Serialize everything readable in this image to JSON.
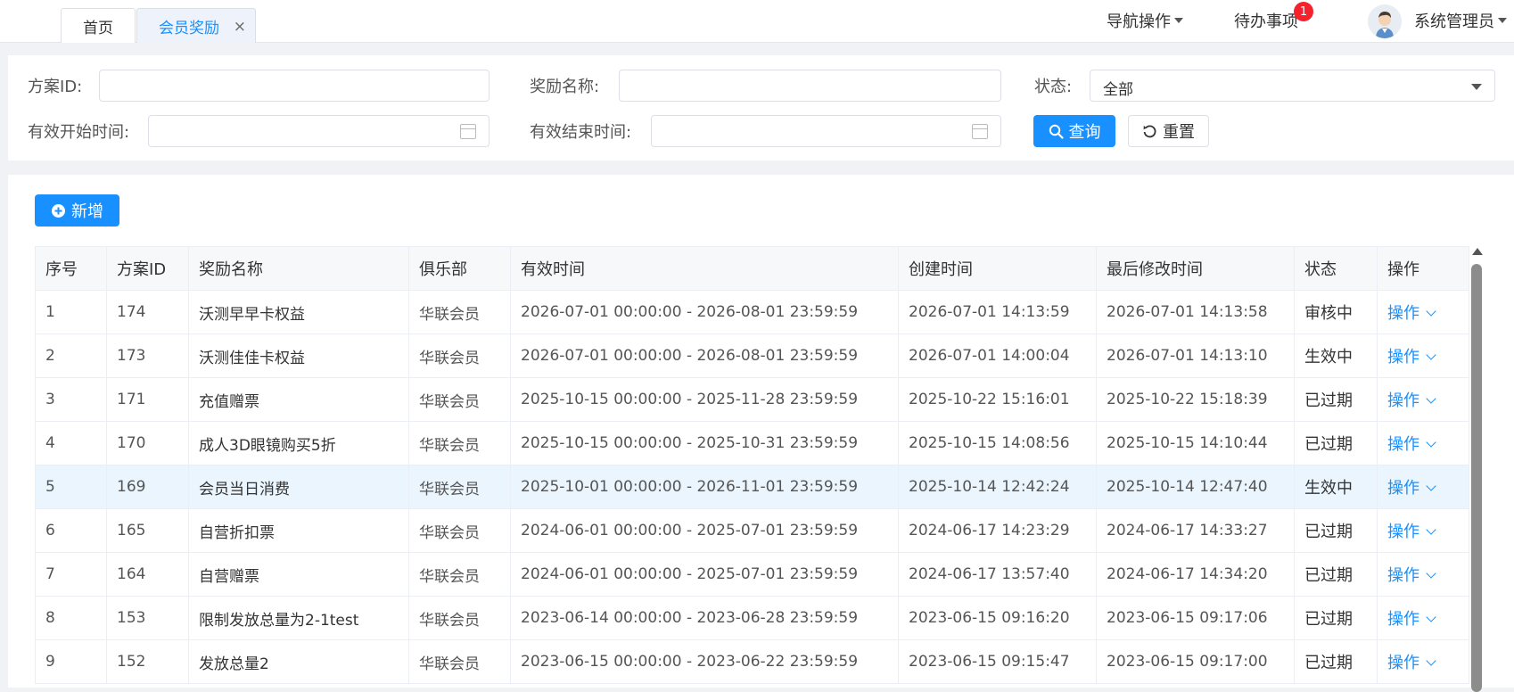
{
  "tabs": [
    {
      "label": "首页"
    },
    {
      "label": "会员奖励",
      "close": "×"
    }
  ],
  "header": {
    "nav_ops": "导航操作",
    "todo": "待办事项",
    "todo_count": "1",
    "user": "系统管理员"
  },
  "filter": {
    "plan_id_label": "方案ID:",
    "reward_name_label": "奖励名称:",
    "status_label": "状态:",
    "status_value": "全部",
    "start_label": "有效开始时间:",
    "end_label": "有效结束时间:",
    "query_btn": "查询",
    "reset_btn": "重置"
  },
  "toolbar": {
    "add_btn": "新增"
  },
  "colors": {
    "primary": "#1890ff",
    "highlight_row": "#eaf5fd",
    "badge": "#f5222d"
  },
  "table": {
    "headers": [
      "序号",
      "方案ID",
      "奖励名称",
      "俱乐部",
      "有效时间",
      "创建时间",
      "最后修改时间",
      "状态",
      "操作"
    ],
    "rows": [
      {
        "no": "1",
        "id": "174",
        "name": "沃测早早卡权益",
        "club": "华联会员",
        "valid": "2026-07-01 00:00:00 - 2026-08-01 23:59:59",
        "created": "2026-07-01 14:13:59",
        "modified": "2026-07-01 14:13:58",
        "status": "审核中",
        "op": "操作"
      },
      {
        "no": "2",
        "id": "173",
        "name": "沃测佳佳卡权益",
        "club": "华联会员",
        "valid": "2026-07-01 00:00:00 - 2026-08-01 23:59:59",
        "created": "2026-07-01 14:00:04",
        "modified": "2026-07-01 14:13:10",
        "status": "生效中",
        "op": "操作"
      },
      {
        "no": "3",
        "id": "171",
        "name": "充值赠票",
        "club": "华联会员",
        "valid": "2025-10-15 00:00:00 - 2025-11-28 23:59:59",
        "created": "2025-10-22 15:16:01",
        "modified": "2025-10-22 15:18:39",
        "status": "已过期",
        "op": "操作"
      },
      {
        "no": "4",
        "id": "170",
        "name": "成人3D眼镜购买5折",
        "club": "华联会员",
        "valid": "2025-10-15 00:00:00 - 2025-10-31 23:59:59",
        "created": "2025-10-15 14:08:56",
        "modified": "2025-10-15 14:10:44",
        "status": "已过期",
        "op": "操作"
      },
      {
        "no": "5",
        "id": "169",
        "name": "会员当日消费",
        "club": "华联会员",
        "valid": "2025-10-01 00:00:00 - 2026-11-01 23:59:59",
        "created": "2025-10-14 12:42:24",
        "modified": "2025-10-14 12:47:40",
        "status": "生效中",
        "op": "操作"
      },
      {
        "no": "6",
        "id": "165",
        "name": "自营折扣票",
        "club": "华联会员",
        "valid": "2024-06-01 00:00:00 - 2025-07-01 23:59:59",
        "created": "2024-06-17 14:23:29",
        "modified": "2024-06-17 14:33:27",
        "status": "已过期",
        "op": "操作"
      },
      {
        "no": "7",
        "id": "164",
        "name": "自营赠票",
        "club": "华联会员",
        "valid": "2024-06-01 00:00:00 - 2025-07-01 23:59:59",
        "created": "2024-06-17 13:57:40",
        "modified": "2024-06-17 14:34:20",
        "status": "已过期",
        "op": "操作"
      },
      {
        "no": "8",
        "id": "153",
        "name": "限制发放总量为2-1test",
        "club": "华联会员",
        "valid": "2023-06-14 00:00:00 - 2023-06-28 23:59:59",
        "created": "2023-06-15 09:16:20",
        "modified": "2023-06-15 09:17:06",
        "status": "已过期",
        "op": "操作"
      },
      {
        "no": "9",
        "id": "152",
        "name": "发放总量2",
        "club": "华联会员",
        "valid": "2023-06-15 00:00:00 - 2023-06-22 23:59:59",
        "created": "2023-06-15 09:15:47",
        "modified": "2023-06-15 09:17:00",
        "status": "已过期",
        "op": "操作"
      }
    ]
  }
}
